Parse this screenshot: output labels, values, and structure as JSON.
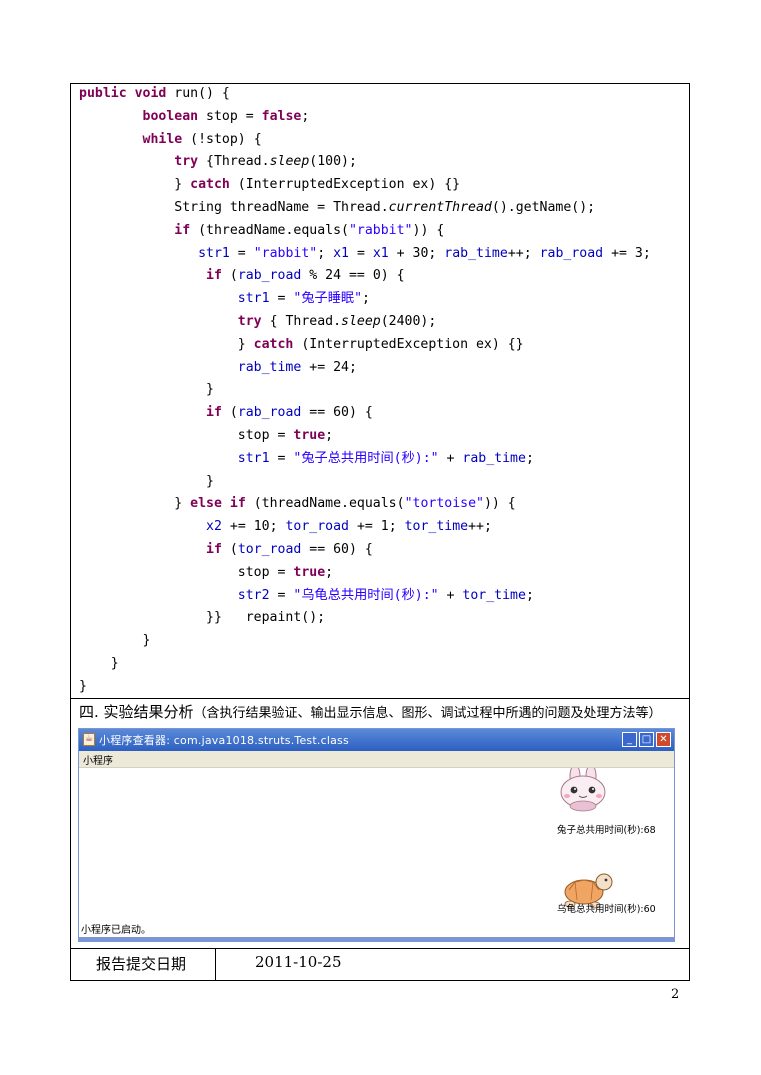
{
  "code_lines": [
    [
      {
        "t": "public",
        "c": "kw"
      },
      {
        "t": " "
      },
      {
        "t": "void",
        "c": "kw"
      },
      {
        "t": " run() {"
      }
    ],
    [
      {
        "t": "        "
      },
      {
        "t": "boolean",
        "c": "kw"
      },
      {
        "t": " stop = "
      },
      {
        "t": "false",
        "c": "kw"
      },
      {
        "t": ";"
      }
    ],
    [
      {
        "t": "        "
      },
      {
        "t": "while",
        "c": "kw"
      },
      {
        "t": " (!stop) {"
      }
    ],
    [
      {
        "t": "            "
      },
      {
        "t": "try",
        "c": "kw"
      },
      {
        "t": " {Thread."
      },
      {
        "t": "sleep",
        "c": "it"
      },
      {
        "t": "(100);"
      }
    ],
    [
      {
        "t": "            } "
      },
      {
        "t": "catch",
        "c": "kw"
      },
      {
        "t": " (InterruptedException ex) {}"
      }
    ],
    [
      {
        "t": "            String threadName = Thread."
      },
      {
        "t": "currentThread",
        "c": "it"
      },
      {
        "t": "().getName();"
      }
    ],
    [
      {
        "t": "            "
      },
      {
        "t": "if",
        "c": "kw"
      },
      {
        "t": " (threadName.equals("
      },
      {
        "t": "\"rabbit\"",
        "c": "str"
      },
      {
        "t": ")) {"
      }
    ],
    [
      {
        "t": "               "
      },
      {
        "t": "str1",
        "c": "fld"
      },
      {
        "t": " = "
      },
      {
        "t": "\"rabbit\"",
        "c": "str"
      },
      {
        "t": "; "
      },
      {
        "t": "x1",
        "c": "fld"
      },
      {
        "t": " = "
      },
      {
        "t": "x1",
        "c": "fld"
      },
      {
        "t": " + 30; "
      },
      {
        "t": "rab_time",
        "c": "fld"
      },
      {
        "t": "++; "
      },
      {
        "t": "rab_road",
        "c": "fld"
      },
      {
        "t": " += 3;"
      }
    ],
    [
      {
        "t": "                "
      },
      {
        "t": "if",
        "c": "kw"
      },
      {
        "t": " ("
      },
      {
        "t": "rab_road",
        "c": "fld"
      },
      {
        "t": " % 24 == 0) {"
      }
    ],
    [
      {
        "t": "                    "
      },
      {
        "t": "str1",
        "c": "fld"
      },
      {
        "t": " = "
      },
      {
        "t": "\"兔子睡眠\"",
        "c": "str"
      },
      {
        "t": ";"
      }
    ],
    [
      {
        "t": "                    "
      },
      {
        "t": "try",
        "c": "kw"
      },
      {
        "t": " { Thread."
      },
      {
        "t": "sleep",
        "c": "it"
      },
      {
        "t": "(2400);"
      }
    ],
    [
      {
        "t": "                    } "
      },
      {
        "t": "catch",
        "c": "kw"
      },
      {
        "t": " (InterruptedException ex) {}"
      }
    ],
    [
      {
        "t": "                    "
      },
      {
        "t": "rab_time",
        "c": "fld"
      },
      {
        "t": " += 24;"
      }
    ],
    [
      {
        "t": "                }"
      }
    ],
    [
      {
        "t": "                "
      },
      {
        "t": "if",
        "c": "kw"
      },
      {
        "t": " ("
      },
      {
        "t": "rab_road",
        "c": "fld"
      },
      {
        "t": " == 60) {"
      }
    ],
    [
      {
        "t": "                    stop = "
      },
      {
        "t": "true",
        "c": "kw"
      },
      {
        "t": ";"
      }
    ],
    [
      {
        "t": "                    "
      },
      {
        "t": "str1",
        "c": "fld"
      },
      {
        "t": " = "
      },
      {
        "t": "\"兔子总共用时间(秒):\"",
        "c": "str"
      },
      {
        "t": " + "
      },
      {
        "t": "rab_time",
        "c": "fld"
      },
      {
        "t": ";"
      }
    ],
    [
      {
        "t": "                }"
      }
    ],
    [
      {
        "t": "            } "
      },
      {
        "t": "else",
        "c": "kw"
      },
      {
        "t": " "
      },
      {
        "t": "if",
        "c": "kw"
      },
      {
        "t": " (threadName.equals("
      },
      {
        "t": "\"tortoise\"",
        "c": "str"
      },
      {
        "t": ")) {"
      }
    ],
    [
      {
        "t": "                "
      },
      {
        "t": "x2",
        "c": "fld"
      },
      {
        "t": " += 10; "
      },
      {
        "t": "tor_road",
        "c": "fld"
      },
      {
        "t": " += 1; "
      },
      {
        "t": "tor_time",
        "c": "fld"
      },
      {
        "t": "++;"
      }
    ],
    [
      {
        "t": "                "
      },
      {
        "t": "if",
        "c": "kw"
      },
      {
        "t": " ("
      },
      {
        "t": "tor_road",
        "c": "fld"
      },
      {
        "t": " == 60) {"
      }
    ],
    [
      {
        "t": "                    stop = "
      },
      {
        "t": "true",
        "c": "kw"
      },
      {
        "t": ";"
      }
    ],
    [
      {
        "t": "                    "
      },
      {
        "t": "str2",
        "c": "fld"
      },
      {
        "t": " = "
      },
      {
        "t": "\"乌龟总共用时间(秒):\"",
        "c": "str"
      },
      {
        "t": " + "
      },
      {
        "t": "tor_time",
        "c": "fld"
      },
      {
        "t": ";"
      }
    ],
    [
      {
        "t": "                }}   repaint();"
      }
    ],
    [
      {
        "t": "        }"
      }
    ],
    [
      {
        "t": "    }"
      }
    ],
    [
      {
        "t": "}"
      }
    ]
  ],
  "section": {
    "title": "四. 实验结果分析",
    "note": "（含执行结果验证、输出显示信息、图形、调试过程中所遇的问题及处理方法等）"
  },
  "applet": {
    "window_title": "小程序查看器: com.java1018.struts.Test.class",
    "menu_label": "小程序",
    "rabbit_label": "兔子总共用时间(秒):68",
    "tortoise_label": "乌龟总共用时间(秒):60",
    "status_text": "小程序已启动。",
    "btn_minimize": "_",
    "btn_maximize": "□",
    "btn_close": "✕",
    "java_icon": "☕",
    "rabbit_icon": "rabbit-icon",
    "tortoise_icon": "tortoise-icon"
  },
  "footer": {
    "date_label": "报告提交日期",
    "date_value": "2011-10-25",
    "page_number": "2"
  },
  "colors": {
    "keyword": "#7f0055",
    "field": "#0000c0",
    "string": "#2a00ff",
    "titlebar": "#2d5fc2"
  }
}
